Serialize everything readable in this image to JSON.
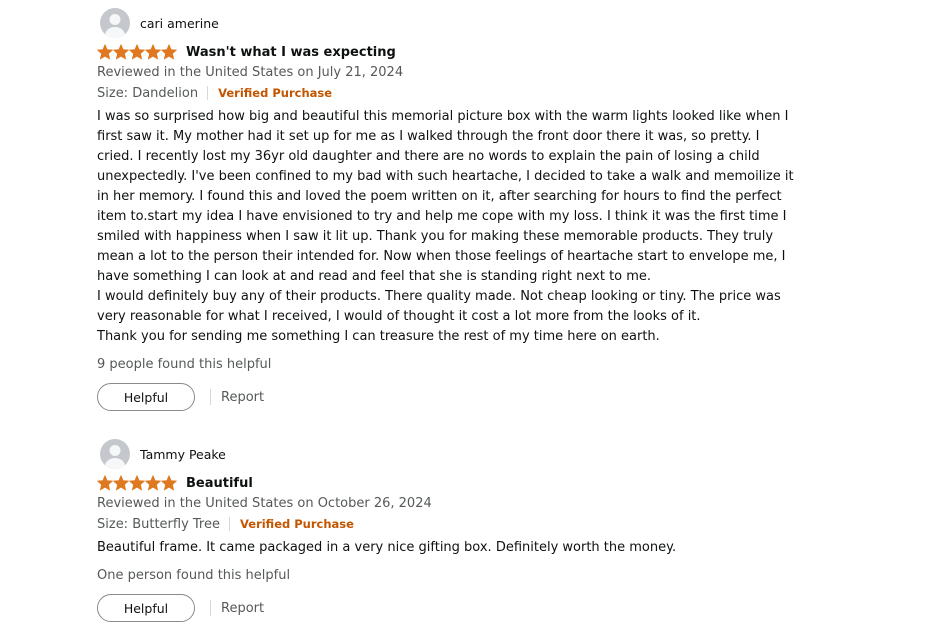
{
  "colors": {
    "star": "#de7921",
    "verified": "#c45500",
    "secondary_text": "#565959",
    "primary_text": "#0f1111",
    "avatar_bg": "#c4c8cc"
  },
  "reviews": [
    {
      "reviewer_name": "cari amerine",
      "avatar_icon": "user-silhouette-icon",
      "rating": 5,
      "rating_max": 5,
      "title": "Wasn't what I was expecting",
      "date_line": "Reviewed in the United States on July 21, 2024",
      "variant": "Size: Dandelion",
      "verified_label": "Verified Purchase",
      "body": [
        "I was so surprised how big and beautiful this memorial picture box with the warm lights looked like when I first saw it. My mother had it set up for me as I walked through the front door there it was, so pretty. I cried. I recently lost my 36yr old daughter and there are no words to explain the pain of losing a child unexpectedly. I've been confined to my bad with such heartache, I decided to take a walk and memoilize it in her memory. I found this and loved the poem written on it, after searching for hours to find the perfect item to.start my idea I have envisioned to try and help me cope with my loss. I think it was the first time I smiled with happiness when I saw it lit up. Thank you for making these memorable products. They truly mean a lot to the person their intended for. Now when those feelings of heartache start to envelope me, I have something I can look at and read and feel that she is standing right next to me.",
        "I would definitely buy any of their products. There quality made. Not cheap looking or tiny. The price was very reasonable for what I received, I would of thought it cost a lot more from the looks of it.",
        "Thank you for sending me something I can treasure the rest of my time here on earth."
      ],
      "helpful_count": "9 people found this helpful",
      "helpful_button": "Helpful",
      "report_label": "Report"
    },
    {
      "reviewer_name": "Tammy Peake",
      "avatar_icon": "user-silhouette-icon",
      "rating": 5,
      "rating_max": 5,
      "title": "Beautiful",
      "date_line": "Reviewed in the United States on October 26, 2024",
      "variant": "Size: Butterfly Tree",
      "verified_label": "Verified Purchase",
      "body": [
        "Beautiful frame. It came packaged in a very nice gifting box. Definitely worth the money."
      ],
      "helpful_count": "One person found this helpful",
      "helpful_button": "Helpful",
      "report_label": "Report"
    }
  ]
}
